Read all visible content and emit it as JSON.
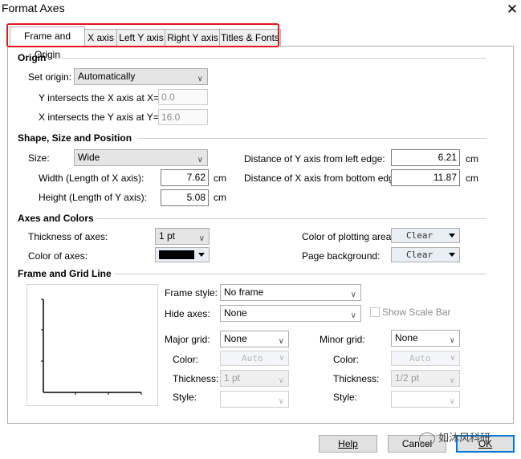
{
  "window": {
    "title": "Format Axes",
    "close_glyph": "✕"
  },
  "tabs": [
    {
      "label": "Frame and Origin",
      "active": true
    },
    {
      "label": "X axis"
    },
    {
      "label": "Left Y axis"
    },
    {
      "label": "Right Y axis"
    },
    {
      "label": "Titles & Fonts"
    }
  ],
  "origin": {
    "heading": "Origin",
    "set_origin_label": "Set origin:",
    "set_origin_value": "Automatically",
    "y_intersects_label": "Y intersects the X axis at X=",
    "y_intersects_value": "0.0",
    "x_intersects_label": "X intersects the Y axis at Y=",
    "x_intersects_value": "16.0"
  },
  "shape": {
    "heading": "Shape, Size and Position",
    "size_label": "Size:",
    "size_value": "Wide",
    "width_label": "Width (Length of X axis):",
    "width_value": "7.62",
    "width_unit": "cm",
    "height_label": "Height (Length of Y axis):",
    "height_value": "5.08",
    "height_unit": "cm",
    "dist_y_label": "Distance of Y axis from left edge:",
    "dist_y_value": "6.21",
    "dist_y_unit": "cm",
    "dist_x_label": "Distance of X axis from bottom edge:",
    "dist_x_value": "11.87",
    "dist_x_unit": "cm"
  },
  "axes_colors": {
    "heading": "Axes and Colors",
    "thickness_label": "Thickness of axes:",
    "thickness_value": "1 pt",
    "color_label": "Color of axes:",
    "color_value": "#000000",
    "plot_area_label": "Color of plotting area:",
    "plot_area_value": "Clear",
    "page_bg_label": "Page background:",
    "page_bg_value": "Clear"
  },
  "frame_grid": {
    "heading": "Frame and Grid Line",
    "frame_style_label": "Frame style:",
    "frame_style_value": "No frame",
    "hide_axes_label": "Hide axes:",
    "hide_axes_value": "None",
    "show_scale_bar_label": "Show Scale Bar",
    "major_grid_label": "Major grid:",
    "major_grid_value": "None",
    "minor_grid_label": "Minor grid:",
    "minor_grid_value": "None",
    "major_color_label": "Color:",
    "major_color_value": "Auto",
    "major_thickness_label": "Thickness:",
    "major_thickness_value": "1 pt",
    "major_style_label": "Style:",
    "minor_color_label": "Color:",
    "minor_color_value": "Auto",
    "minor_thickness_label": "Thickness:",
    "minor_thickness_value": "1/2 pt",
    "minor_style_label": "Style:"
  },
  "buttons": {
    "help": "Help",
    "cancel": "Cancel",
    "ok": "OK"
  },
  "watermark": {
    "text": "如沐风科研"
  },
  "colors": {
    "highlight_box": "#e8141b",
    "ok_border": "#0078d7"
  }
}
